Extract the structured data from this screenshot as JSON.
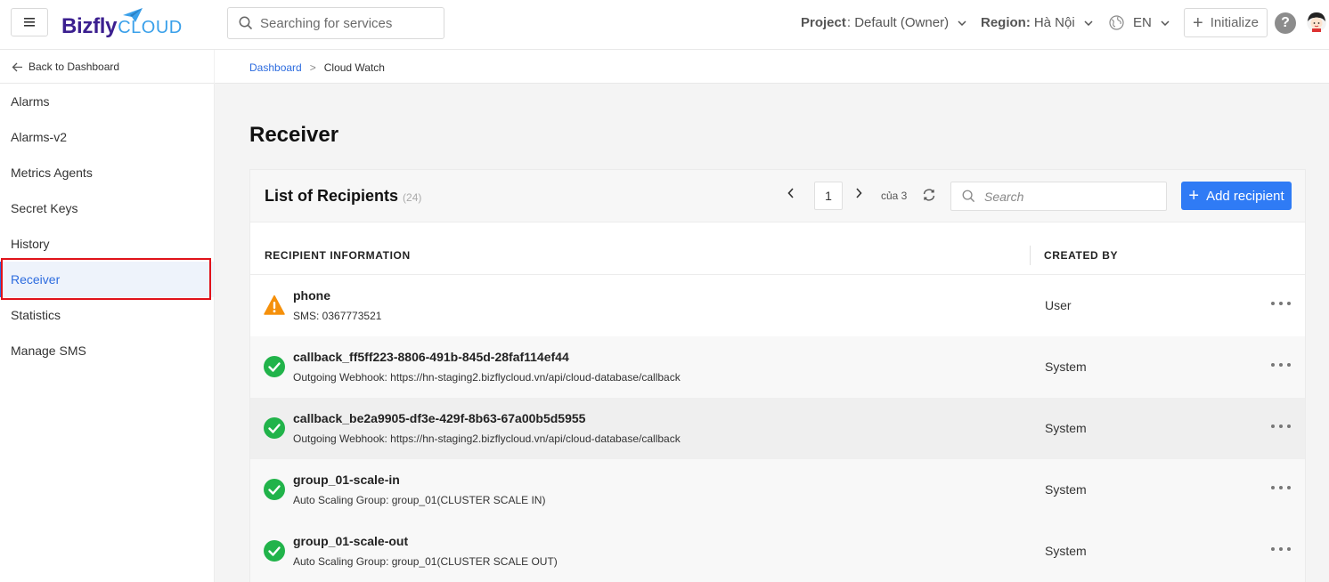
{
  "header": {
    "logo_primary": "Bizfly",
    "logo_secondary": "CLOUD",
    "search_placeholder": "Searching for services",
    "project_label": "Project",
    "project_value": ": Default (Owner)",
    "region_label": "Region:",
    "region_value": "Hà Nội",
    "language": "EN",
    "initialize_label": "Initialize",
    "help_label": "?"
  },
  "subbar": {
    "back_label": "Back to Dashboard",
    "breadcrumb": [
      "Dashboard",
      ">",
      "Cloud Watch"
    ]
  },
  "sidebar": {
    "items": [
      {
        "label": "Alarms"
      },
      {
        "label": "Alarms-v2"
      },
      {
        "label": "Metrics Agents"
      },
      {
        "label": "Secret Keys"
      },
      {
        "label": "History"
      },
      {
        "label": "Receiver",
        "active": true
      },
      {
        "label": "Statistics"
      },
      {
        "label": "Manage SMS"
      }
    ]
  },
  "main": {
    "page_title": "Receiver",
    "card": {
      "title": "List of Recipients",
      "count": "(24)",
      "current_page": "1",
      "of_pages": "của 3",
      "search_placeholder": "Search",
      "add_label": "Add recipient",
      "columns": [
        "RECIPIENT INFORMATION",
        "CREATED BY"
      ],
      "rows": [
        {
          "status": "warning",
          "name": "phone",
          "detail": "SMS: 0367773521",
          "created_by": "User"
        },
        {
          "status": "ok",
          "name": "callback_ff5ff223-8806-491b-845d-28faf114ef44",
          "detail": "Outgoing Webhook: https://hn-staging2.bizflycloud.vn/api/cloud-database/callback",
          "created_by": "System"
        },
        {
          "status": "ok",
          "name": "callback_be2a9905-df3e-429f-8b63-67a00b5d5955",
          "detail": "Outgoing Webhook: https://hn-staging2.bizflycloud.vn/api/cloud-database/callback",
          "created_by": "System"
        },
        {
          "status": "ok",
          "name": "group_01-scale-in",
          "detail": "Auto Scaling Group: group_01(CLUSTER SCALE IN)",
          "created_by": "System"
        },
        {
          "status": "ok",
          "name": "group_01-scale-out",
          "detail": "Auto Scaling Group: group_01(CLUSTER SCALE OUT)",
          "created_by": "System"
        }
      ]
    }
  },
  "colors": {
    "accent": "#2f7bf5",
    "link": "#2d6cdf",
    "ok": "#21b34a",
    "warning": "#f5900b",
    "highlight_border": "#e0121a"
  }
}
